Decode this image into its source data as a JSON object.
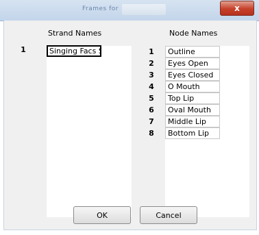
{
  "window": {
    "title_partial": "Frames for",
    "close_label": "x"
  },
  "strands": {
    "header": "Strand Names",
    "rows": [
      {
        "num": "1",
        "name": "Singing Facs S"
      }
    ]
  },
  "nodes": {
    "header": "Node Names",
    "rows": [
      {
        "num": "1",
        "name": "Outline"
      },
      {
        "num": "2",
        "name": "Eyes Open"
      },
      {
        "num": "3",
        "name": "Eyes Closed"
      },
      {
        "num": "4",
        "name": "O Mouth"
      },
      {
        "num": "5",
        "name": "Top Lip"
      },
      {
        "num": "6",
        "name": "Oval Mouth"
      },
      {
        "num": "7",
        "name": "Middle Lip"
      },
      {
        "num": "8",
        "name": "Bottom Lip"
      }
    ]
  },
  "buttons": {
    "ok": "OK",
    "cancel": "Cancel"
  }
}
